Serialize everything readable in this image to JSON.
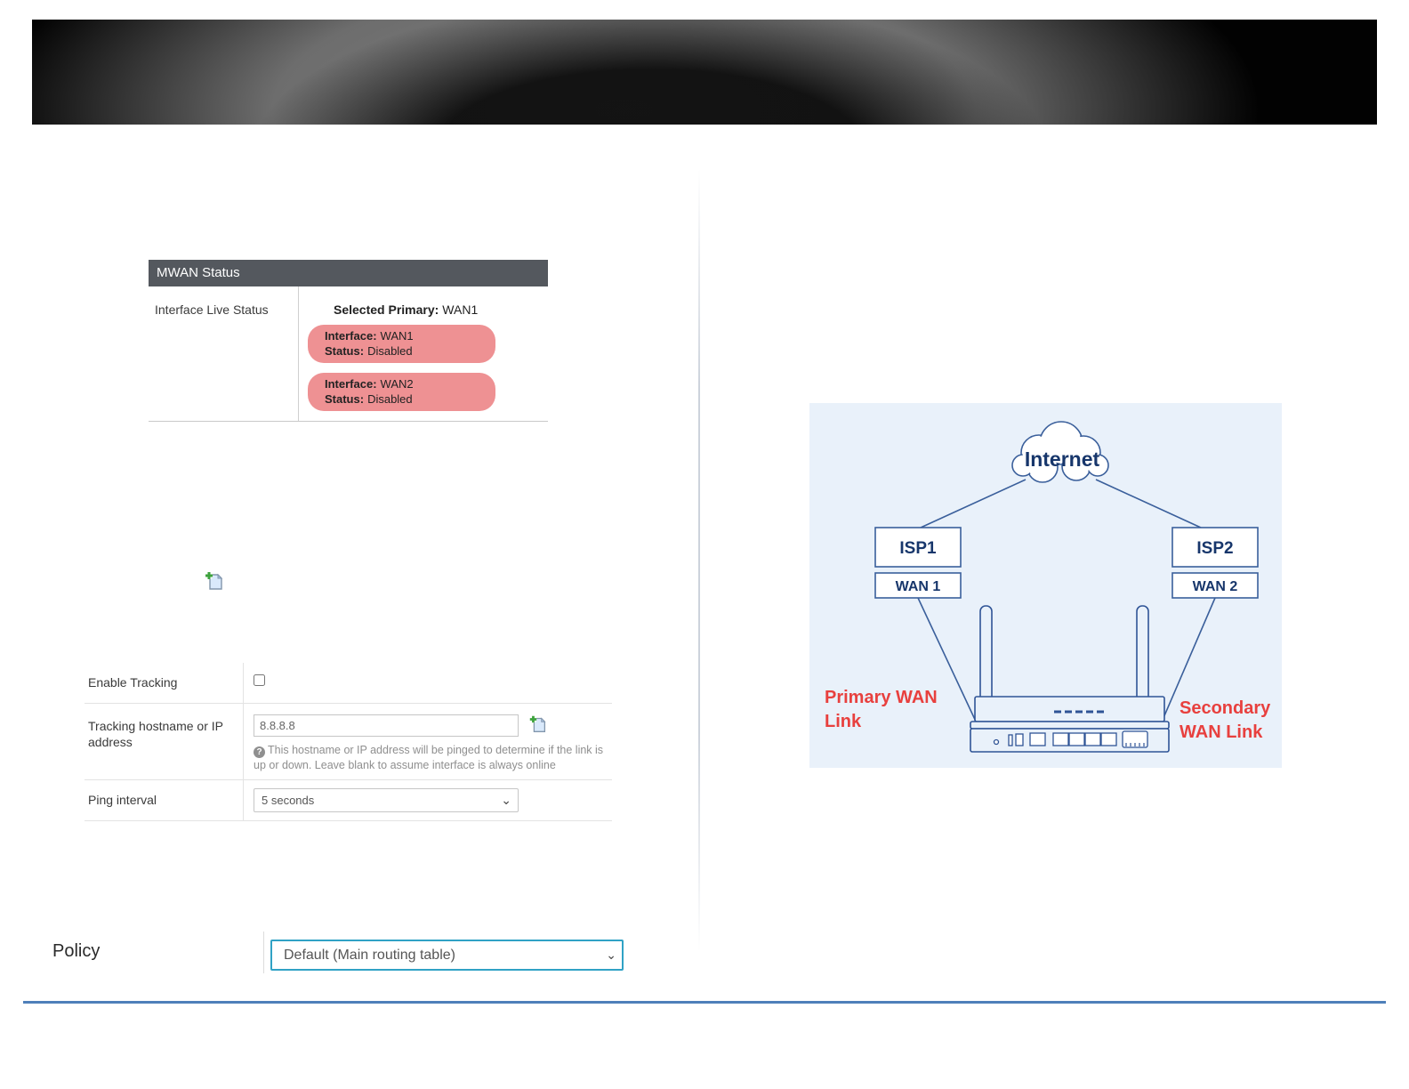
{
  "mwan_status": {
    "title": "MWAN Status",
    "interface_live_status_label": "Interface Live Status",
    "selected_primary_label": "Selected Primary:",
    "selected_primary_value": "WAN1",
    "badges": [
      {
        "interface_label": "Interface:",
        "interface_value": "WAN1",
        "status_label": "Status:",
        "status_value": "Disabled"
      },
      {
        "interface_label": "Interface:",
        "interface_value": "WAN2",
        "status_label": "Status:",
        "status_value": "Disabled"
      }
    ]
  },
  "tracking_form": {
    "enable_tracking_label": "Enable Tracking",
    "tracking_host_label": "Tracking hostname or IP address",
    "tracking_host_value": "8.8.8.8",
    "tracking_help_text": "This hostname or IP address will be pinged to determine if the link is up or down. Leave blank to assume interface is always online",
    "ping_interval_label": "Ping interval",
    "ping_interval_value": "5 seconds"
  },
  "policy": {
    "label": "Policy",
    "value": "Default (Main routing table)"
  },
  "diagram": {
    "internet_label": "Internet",
    "isp1_label": "ISP1",
    "wan1_label": "WAN 1",
    "isp2_label": "ISP2",
    "wan2_label": "WAN 2",
    "primary_wan_label": "Primary WAN Link",
    "secondary_wan_label": "Secondary WAN Link"
  },
  "icons": {
    "help": "?",
    "chevron": "⌄"
  },
  "colors": {
    "badge_pink": "#ee9193",
    "table_header_gray": "#54585e",
    "diagram_bg": "#e9f1fa",
    "diagram_line_navy": "#2f5496",
    "label_red": "#e8403e",
    "bottom_rule_blue": "#4e80ba",
    "policy_select_border": "#30a2c5"
  }
}
